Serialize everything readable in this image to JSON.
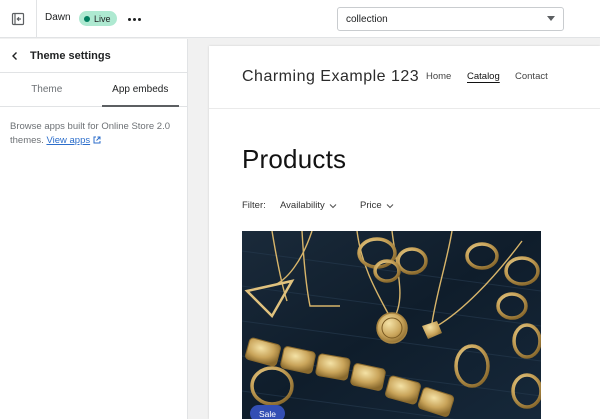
{
  "topbar": {
    "theme_name": "Dawn",
    "live_label": "Live",
    "template_select": "collection"
  },
  "sidebar": {
    "title": "Theme settings",
    "tabs": [
      {
        "label": "Theme",
        "active": false
      },
      {
        "label": "App embeds",
        "active": true
      }
    ],
    "description": "Browse apps built for Online Store 2.0 themes.",
    "link_label": "View apps"
  },
  "preview": {
    "store_name": "Charming Example 123",
    "nav": [
      {
        "label": "Home",
        "active": false
      },
      {
        "label": "Catalog",
        "active": true
      },
      {
        "label": "Contact",
        "active": false
      }
    ],
    "page_title": "Products",
    "filter_label": "Filter:",
    "filters": [
      {
        "label": "Availability"
      },
      {
        "label": "Price"
      }
    ],
    "product": {
      "badge": "Sale"
    }
  },
  "colors": {
    "live_badge_bg": "#aee9d1",
    "link": "#2c6ecb",
    "sale_badge": "#334fb4"
  }
}
